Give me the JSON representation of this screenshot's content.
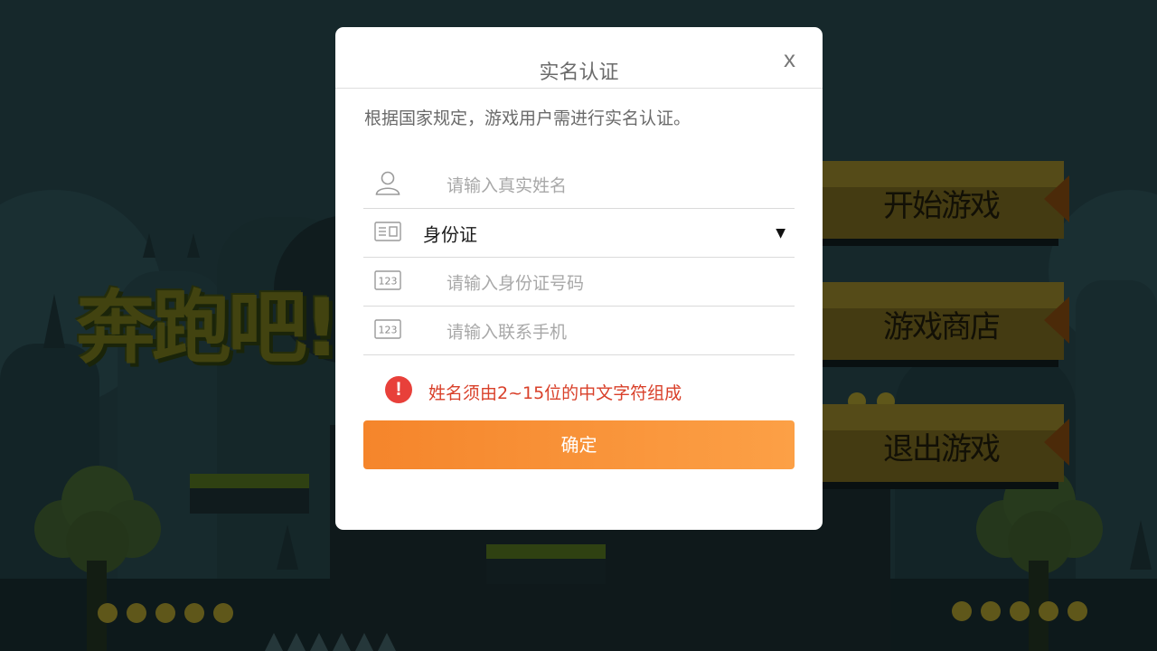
{
  "game": {
    "title": "奔跑吧!",
    "menu": [
      "开始游戏",
      "游戏商店",
      "退出游戏"
    ]
  },
  "dialog": {
    "title": "实名认证",
    "close_label": "x",
    "notice": "根据国家规定，游戏用户需进行实名认证。",
    "name_placeholder": "请输入真实姓名",
    "id_type_value": "身份证",
    "id_type_arrow": "▼",
    "id_number_placeholder": "请输入身份证号码",
    "phone_placeholder": "请输入联系手机",
    "error_icon": "!",
    "error_message": "姓名须由2~15位的中文字符组成",
    "confirm_label": "确定"
  },
  "colors": {
    "accent": "#f5852b",
    "error": "#d9402a",
    "background": "#1d3338"
  }
}
